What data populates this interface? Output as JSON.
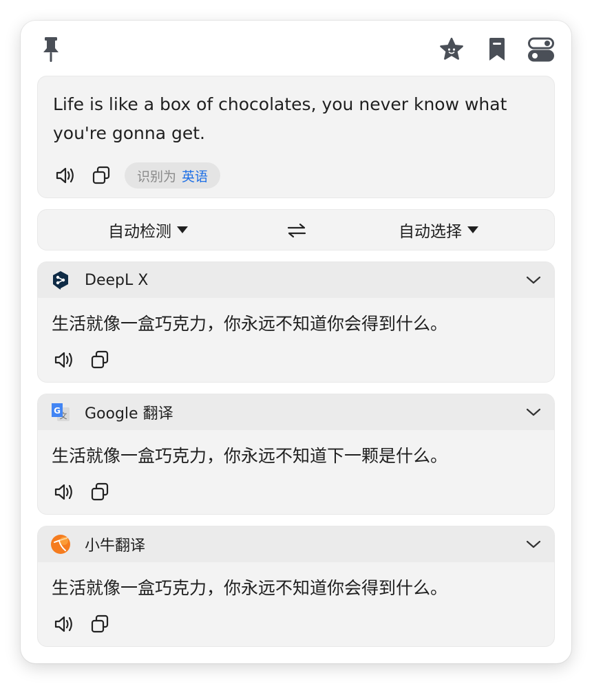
{
  "source": {
    "text": "Life is like a box of chocolates, you never know what you're gonna get.",
    "detected_prefix": "识别为",
    "detected_language": "英语"
  },
  "languages": {
    "source": "自动检测",
    "target": "自动选择"
  },
  "services": [
    {
      "name": "DeepL X",
      "logo_icon": "deepl-logo-icon",
      "result": "生活就像一盒巧克力，你永远不知道你会得到什么。"
    },
    {
      "name": "Google 翻译",
      "logo_icon": "google-translate-logo-icon",
      "result": "生活就像一盒巧克力，你永远不知道下一颗是什么。"
    },
    {
      "name": "小牛翻译",
      "logo_icon": "niutrans-logo-icon",
      "result": "生活就像一盒巧克力，你永远不知道你会得到什么。"
    }
  ],
  "colors": {
    "accent_blue": "#1d6fe6",
    "icon_gray": "#4a4f57",
    "deepl_navy": "#0f2b46",
    "google_blue": "#4285f4",
    "niutrans_orange": "#f57c1f"
  }
}
